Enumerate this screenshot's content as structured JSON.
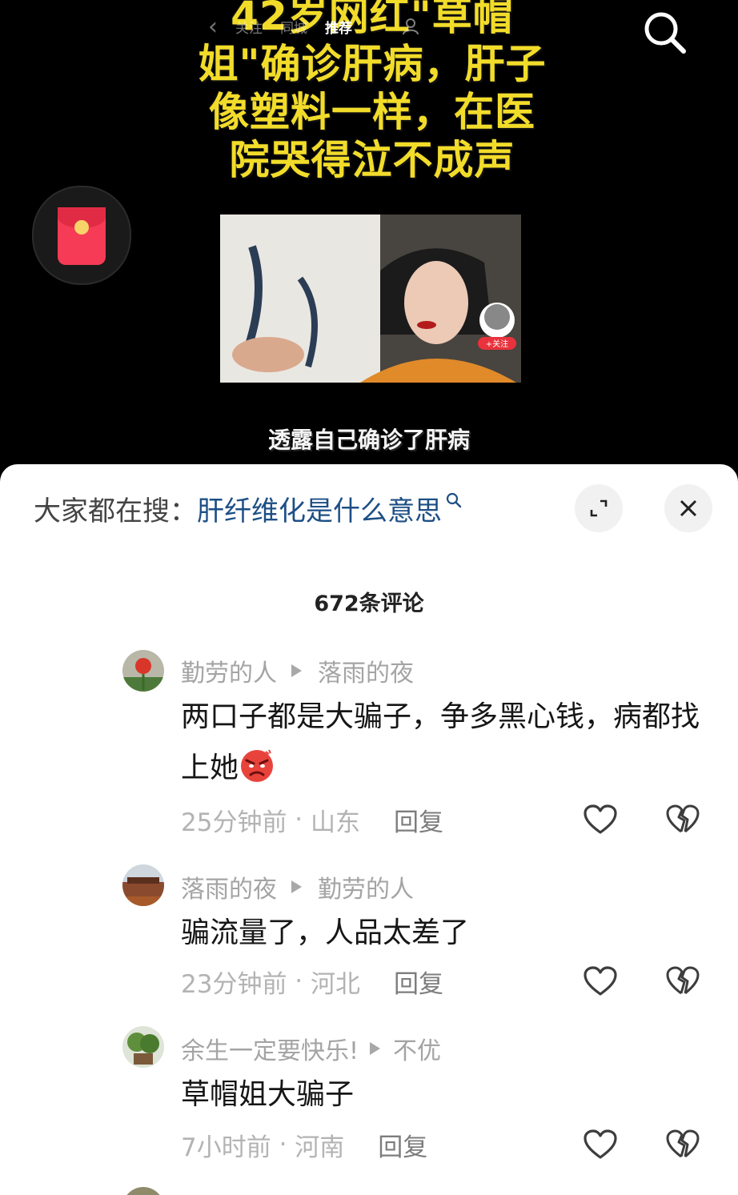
{
  "top_nav": {
    "back": "‹",
    "items": [
      "关注",
      "同城",
      "推荐"
    ],
    "active_index": 2
  },
  "video": {
    "headline_lines": [
      "42岁网红\"草帽",
      "姐\"确诊肝病，肝子",
      "像塑料一样，在医",
      "院哭得泣不成声"
    ],
    "thumb_follow_badge": "+关注",
    "caption": "透露自己确诊了肝病"
  },
  "comment_sheet": {
    "search_label": "大家都在搜：",
    "search_query": "肝纤维化是什么意思",
    "title": "672条评论"
  },
  "comments": [
    {
      "user": "勤劳的人",
      "reply_to": "落雨的夜",
      "text": "两口子都是大骗子，争多黑心钱，病都找上她",
      "emoji": "angry-face",
      "time": "25分钟前",
      "location": "山东",
      "reply_label": "回复"
    },
    {
      "user": "落雨的夜",
      "reply_to": "勤劳的人",
      "text": "骗流量了，人品太差了",
      "time": "23分钟前",
      "location": "河北",
      "reply_label": "回复"
    },
    {
      "user": "余生一定要快乐!",
      "reply_to": "不优",
      "text": "草帽姐大骗子",
      "time": "7小时前",
      "location": "河南",
      "reply_label": "回复"
    }
  ],
  "colors": {
    "headline": "#f2dc2a",
    "search_query": "#1d4f86",
    "red_packet": "#f53b55",
    "muted_text": "#a4a4a4"
  }
}
